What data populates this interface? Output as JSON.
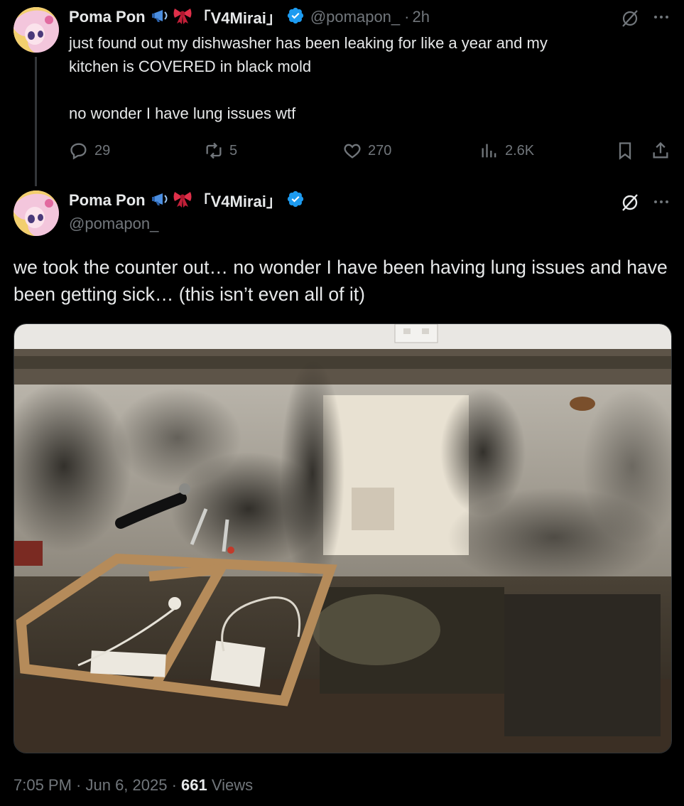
{
  "tweet1": {
    "name": "Poma Pon",
    "tag": "「V4Mirai」",
    "handle": "@pomapon_",
    "separator": "·",
    "time": "2h",
    "text": "just found out my dishwasher has been leaking for like a year and my\nkitchen is COVERED in black mold\n\nno wonder I have lung issues wtf",
    "replies": "29",
    "reposts": "5",
    "likes": "270",
    "views": "2.6K"
  },
  "tweet2": {
    "name": "Poma Pon",
    "tag": "「V4Mirai」",
    "handle": "@pomapon_",
    "text": "we took the counter out… no wonder I have been having lung issues and have been getting sick… (this isn’t even all of it)",
    "timestamp": "7:05 PM · Jun 6, 2025 · ",
    "view_count": "661",
    "views_label": " Views"
  },
  "icons": [
    "megaphone-emoji",
    "ribbon-emoji",
    "verified-badge-icon",
    "grok-icon",
    "more-icon",
    "reply-icon",
    "repost-icon",
    "like-icon",
    "views-icon",
    "bookmark-icon",
    "share-icon"
  ],
  "colors": {
    "background": "#000000",
    "text": "#e7e9ea",
    "muted": "#71767b",
    "verified": "#1d9bf0"
  }
}
